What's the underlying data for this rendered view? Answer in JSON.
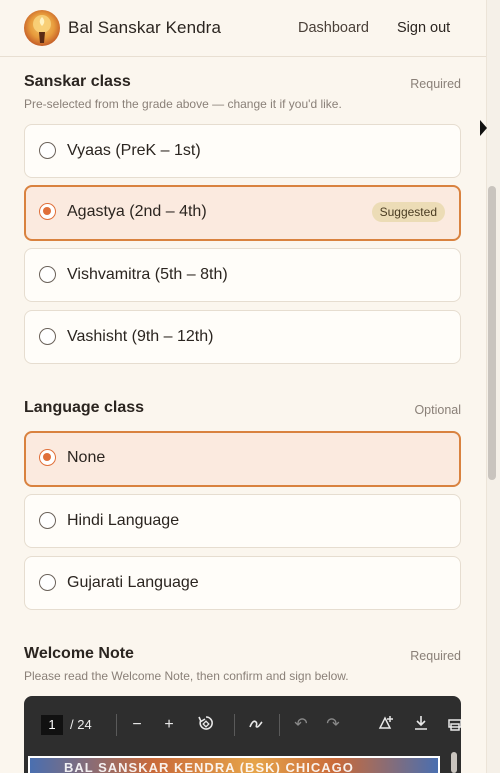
{
  "app": {
    "brand": "Bal Sanskar Kendra",
    "nav": {
      "dashboard": "Dashboard",
      "signout": "Sign out"
    }
  },
  "sanskar": {
    "title": "Sanskar class",
    "tag": "Required",
    "subtitle": "Pre-selected from the grade above — change it if you'd like.",
    "options": [
      {
        "label": "Vyaas (PreK – 1st)",
        "selected": false
      },
      {
        "label": "Agastya (2nd – 4th)",
        "selected": true,
        "badge": "Suggested"
      },
      {
        "label": "Vishvamitra (5th – 8th)",
        "selected": false
      },
      {
        "label": "Vashisht (9th – 12th)",
        "selected": false
      }
    ]
  },
  "language": {
    "title": "Language class",
    "tag": "Optional",
    "options": [
      {
        "label": "None",
        "selected": true
      },
      {
        "label": "Hindi Language",
        "selected": false
      },
      {
        "label": "Gujarati Language",
        "selected": false
      }
    ]
  },
  "welcome": {
    "title": "Welcome Note",
    "tag": "Required",
    "subtitle": "Please read the Welcome Note, then confirm and sign below."
  },
  "pdf": {
    "current_page": "1",
    "total": "/ 24",
    "page_heading": "BAL SANSKAR KENDRA (BSK) CHICAGO",
    "icons": [
      "zoom-out-icon",
      "zoom-in-icon",
      "rotate-icon",
      "draw-icon",
      "undo-icon",
      "redo-icon",
      "add-text-icon",
      "download-icon",
      "print-icon"
    ]
  },
  "colors": {
    "background": "#fbf6ee",
    "accent": "#d9823f",
    "radio_selected": "#e0703a",
    "selected_bg": "#fbeadf",
    "badge_bg": "#ecdcb6"
  }
}
